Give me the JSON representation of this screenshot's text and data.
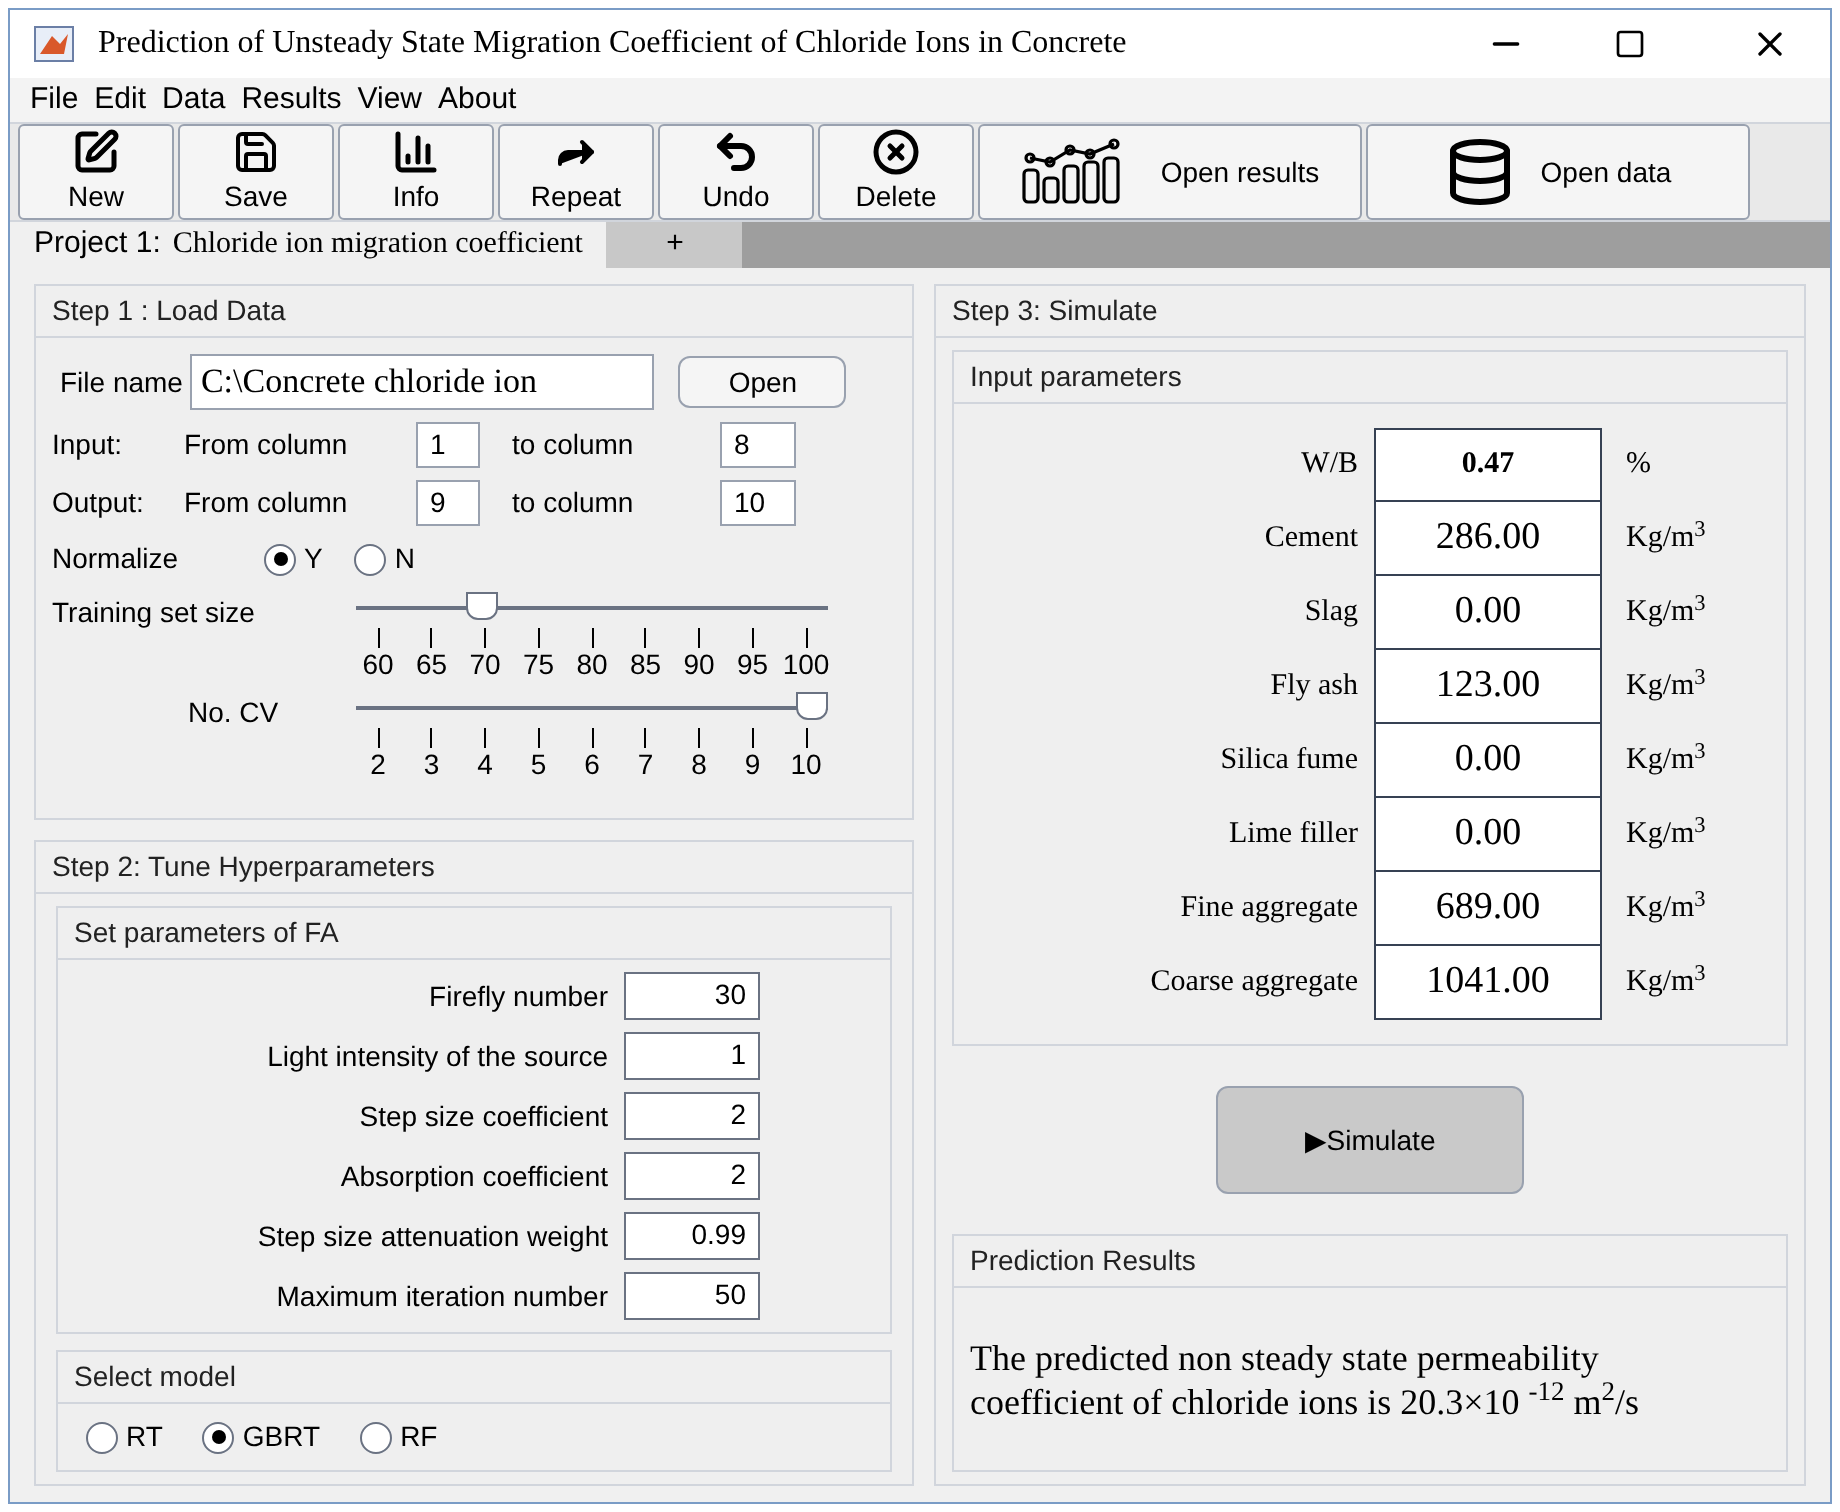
{
  "window": {
    "title": "Prediction of  Unsteady State Migration Coefficient of Chloride Ions in Concrete"
  },
  "menu": [
    "File",
    "Edit",
    "Data",
    "Results",
    "View",
    "About"
  ],
  "toolbar": [
    {
      "kind": "new",
      "label": "New"
    },
    {
      "kind": "save",
      "label": "Save"
    },
    {
      "kind": "info",
      "label": "Info"
    },
    {
      "kind": "repeat",
      "label": "Repeat"
    },
    {
      "kind": "undo",
      "label": "Undo"
    },
    {
      "kind": "delete",
      "label": "Delete"
    },
    {
      "kind": "results",
      "label": "Open results"
    },
    {
      "kind": "data",
      "label": "Open data"
    }
  ],
  "tabs": [
    {
      "prefix": "Project 1:",
      "label": "Chloride ion migration coefficient",
      "selected": true
    },
    {
      "label": "+",
      "selected": false
    }
  ],
  "step1": {
    "title": "Step 1 : Load Data",
    "file_label": "File name",
    "file_value": "C:\\Concrete chloride ion",
    "open_button": "Open",
    "input": {
      "label": "Input:",
      "from_label": "From column",
      "from": "1",
      "to_label": "to column",
      "to": "8"
    },
    "output": {
      "label": "Output:",
      "from_label": "From column",
      "from": "9",
      "to_label": "to column",
      "to": "10"
    },
    "normalize": {
      "label": "Normalize",
      "options": [
        {
          "label": "Y",
          "selected": true
        },
        {
          "label": "N",
          "selected": false
        }
      ]
    },
    "sliders": [
      {
        "label": "Training set size",
        "level": 0.25,
        "ticks": [
          "60",
          "65",
          "70",
          "75",
          "80",
          "85",
          "90",
          "95",
          "100"
        ]
      },
      {
        "label": "No. CV",
        "level": 1,
        "ticks": [
          "2",
          "3",
          "4",
          "5",
          "6",
          "7",
          "8",
          "9",
          "10"
        ]
      }
    ]
  },
  "step2": {
    "title": "Step 2: Tune Hyperparameters",
    "fa_title": "Set parameters of FA",
    "params": [
      {
        "label": "Firefly number",
        "value": "30"
      },
      {
        "label": "Light intensity of the source",
        "value": "1"
      },
      {
        "label": "Step size coefficient",
        "value": "2"
      },
      {
        "label": "Absorption coefficient",
        "value": "2"
      },
      {
        "label": "Step size attenuation weight",
        "value": "0.99"
      },
      {
        "label": "Maximum iteration number",
        "value": "50"
      }
    ],
    "model_title": "Select model",
    "models": [
      {
        "label": "RT",
        "selected": false
      },
      {
        "label": "GBRT",
        "selected": true
      },
      {
        "label": "RF",
        "selected": false
      }
    ]
  },
  "step3": {
    "title": "Step 3: Simulate",
    "inputs_title": "Input parameters",
    "inputs": [
      {
        "label": "W/B",
        "value": "0.47",
        "unit": "%",
        "bold": true
      },
      {
        "label": "Cement",
        "value": "286.00",
        "unit": "Kg/m$^{3}$",
        "bold": false
      },
      {
        "label": "Slag",
        "value": "0.00",
        "unit": "Kg/m$^{3}$",
        "bold": false
      },
      {
        "label": "Fly ash",
        "value": "123.00",
        "unit": "Kg/m$^{3}$",
        "bold": false
      },
      {
        "label": "Silica fume",
        "value": "0.00",
        "unit": "Kg/m$^{3}$",
        "bold": false
      },
      {
        "label": "Lime filler",
        "value": "0.00",
        "unit": "Kg/m$^{3}$",
        "bold": false
      },
      {
        "label": "Fine aggregate",
        "value": "689.00",
        "unit": "Kg/m$^{3}$",
        "bold": false
      },
      {
        "label": "Coarse aggregate",
        "value": "1041.00",
        "unit": "Kg/m$^{3}$",
        "bold": false
      }
    ],
    "simulate_button": "▶Simulate",
    "results_title": "Prediction Results",
    "result": "The predicted non steady state permeability coefficient of chloride ions is 20.3×10 $^{-12}$ m$^{2}$/s"
  }
}
